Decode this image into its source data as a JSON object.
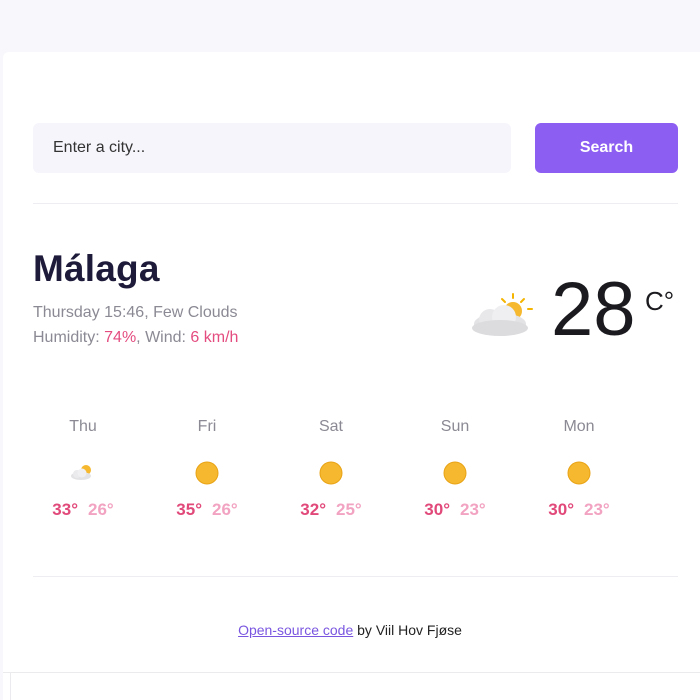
{
  "search": {
    "placeholder": "Enter a city...",
    "value": "",
    "button_label": "Search"
  },
  "current": {
    "city": "Málaga",
    "datetime": "Thursday 15:46",
    "condition": "Few Clouds",
    "humidity_label": "Humidity:",
    "humidity": "74%",
    "wind_label": "Wind:",
    "wind": "6 km/h",
    "temperature": "28",
    "unit": "C°",
    "icon": "few-clouds-icon"
  },
  "forecast": [
    {
      "day": "Thu",
      "high": "33°",
      "low": "26°",
      "icon": "few-clouds-icon"
    },
    {
      "day": "Fri",
      "high": "35°",
      "low": "26°",
      "icon": "sun-icon"
    },
    {
      "day": "Sat",
      "high": "32°",
      "low": "25°",
      "icon": "sun-icon"
    },
    {
      "day": "Sun",
      "high": "30°",
      "low": "23°",
      "icon": "sun-icon"
    },
    {
      "day": "Mon",
      "high": "30°",
      "low": "23°",
      "icon": "sun-icon"
    }
  ],
  "footer": {
    "link_text": "Open-source code",
    "suffix": " by Viil Hov Fjøse"
  },
  "colors": {
    "accent": "#8d5ef2",
    "highlight": "#e44c80",
    "low_temp": "#f2a3c1"
  }
}
